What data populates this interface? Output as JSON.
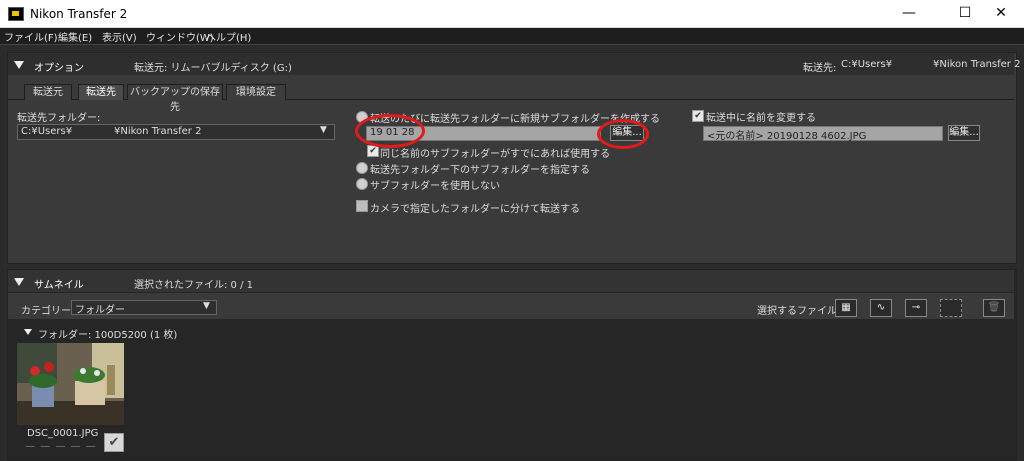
{
  "window": {
    "title": "Nikon Transfer 2"
  },
  "menu": [
    "ファイル(F)",
    "編集(E)",
    "表示(V)",
    "ウィンドウ(W)",
    "ヘルプ(H)"
  ],
  "options": {
    "header_label": "オプション",
    "source": "転送元: リムーバブルディスク (G:)",
    "dest_prefix": "転送先:",
    "dest_user": "C:¥Users¥",
    "dest_folder": "¥Nikon Transfer 2",
    "tabs": [
      "転送元",
      "転送先",
      "バックアップの保存先",
      "環境設定"
    ],
    "active_tab": "転送先",
    "dest_folder_label": "転送先フォルダー:",
    "dest_folder_value_user": "C:¥Users¥",
    "dest_folder_value_name": "¥Nikon Transfer 2",
    "radio_new_subfolder": "転送のたびに転送先フォルダーに新規サブフォルダーを作成する",
    "subfolder_name_value": "19 01 28",
    "edit_label": "編集...",
    "chk_same_name": "同じ名前のサブフォルダーがすでにあれば使用する",
    "radio_specify_sub": "転送先フォルダー下のサブフォルダーを指定する",
    "radio_no_sub": "サブフォルダーを使用しない",
    "chk_split_camera": "カメラで指定したフォルダーに分けて転送する",
    "chk_rename": "転送中に名前を変更する",
    "rename_value": "<元の名前> 20190128 4602.JPG",
    "rename_edit_label": "編集..."
  },
  "thumbnails": {
    "header_label": "サムネイル",
    "selected_files": "選択されたファイル: 0 / 1",
    "category_label": "カテゴリー:",
    "category_value": "フォルダー",
    "select_files_label": "選択するファイル:",
    "folder_label": "フォルダー: 100D5200 (1 枚)",
    "items": [
      {
        "filename": "DSC_0001.JPG",
        "rating": "— — — — —",
        "checked": true
      }
    ]
  },
  "colors": {
    "highlight_circle": "#e21a1a",
    "panel_bg": "#3a3a3a"
  }
}
